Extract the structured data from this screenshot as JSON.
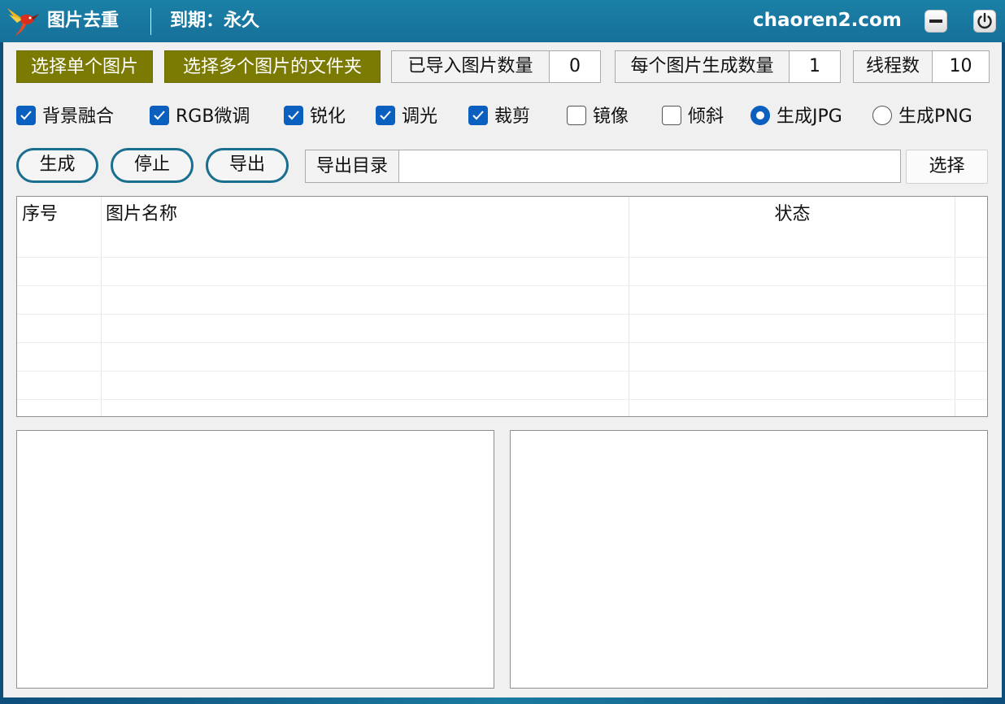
{
  "app": {
    "title": "图片去重",
    "expire": "到期：永久",
    "site": "chaoren2.com",
    "logo_icon": "hummingbird-logo-icon",
    "window_buttons": [
      "minimize-icon",
      "power-icon"
    ]
  },
  "toolbar": {
    "select_single": "选择单个图片",
    "select_folder": "选择多个图片的文件夹",
    "imported_label": "已导入图片数量",
    "imported_value": "0",
    "per_image_label": "每个图片生成数量",
    "per_image_value": "1",
    "threads_label": "线程数",
    "threads_value": "10"
  },
  "options": {
    "bg_blend": "背景融合",
    "rgb_tune": "RGB微调",
    "sharpen": "锐化",
    "light": "调光",
    "crop": "裁剪",
    "mirror": "镜像",
    "tilt": "倾斜",
    "jpg": "生成JPG",
    "png": "生成PNG",
    "checked": {
      "bg_blend": true,
      "rgb_tune": true,
      "sharpen": true,
      "light": true,
      "crop": true,
      "mirror": false,
      "tilt": false
    },
    "format_selected": "jpg"
  },
  "actions": {
    "generate": "生成",
    "stop": "停止",
    "export": "导出",
    "export_dir_label": "导出目录",
    "export_dir_value": "",
    "choose": "选择"
  },
  "table": {
    "columns": [
      "序号",
      "图片名称",
      "状态"
    ],
    "rows": []
  },
  "colors": {
    "title_bar": "#1b80a6",
    "olive_button": "#7b7a03",
    "checkbox_blue": "#0a5fbf",
    "pill_border": "#1a6e8e",
    "client_bg": "#f0f0f0"
  }
}
